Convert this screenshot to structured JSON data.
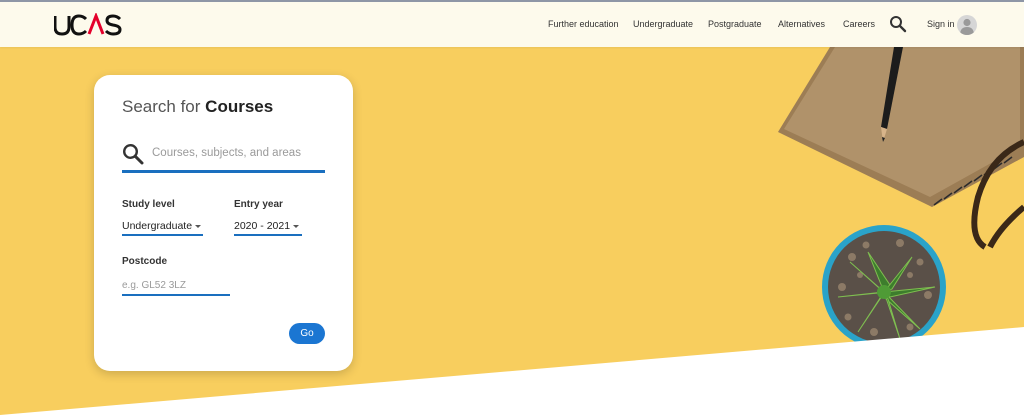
{
  "header": {
    "logo": "UCAS",
    "nav": [
      {
        "label": "Further education"
      },
      {
        "label": "Undergraduate"
      },
      {
        "label": "Postgraduate"
      },
      {
        "label": "Alternatives"
      },
      {
        "label": "Careers"
      }
    ],
    "search_icon": "search-icon",
    "signin_label": "Sign in",
    "avatar_icon": "user-avatar-icon"
  },
  "search_card": {
    "title_prefix": "Search for",
    "title_strong": "Courses",
    "search": {
      "placeholder": "Courses, subjects, and areas",
      "value": ""
    },
    "study_level": {
      "label": "Study level",
      "value": "Undergraduate"
    },
    "entry_year": {
      "label": "Entry year",
      "value": "2020 - 2021"
    },
    "postcode": {
      "label": "Postcode",
      "placeholder": "e.g. GL52 3LZ",
      "value": ""
    },
    "go_label": "Go"
  },
  "colors": {
    "hero_yellow": "#f8ce5e",
    "header_bg": "#fdfaec",
    "accent_blue": "#1a6fbf",
    "button_blue": "#1b76d2",
    "logo_red": "#e4002b"
  }
}
